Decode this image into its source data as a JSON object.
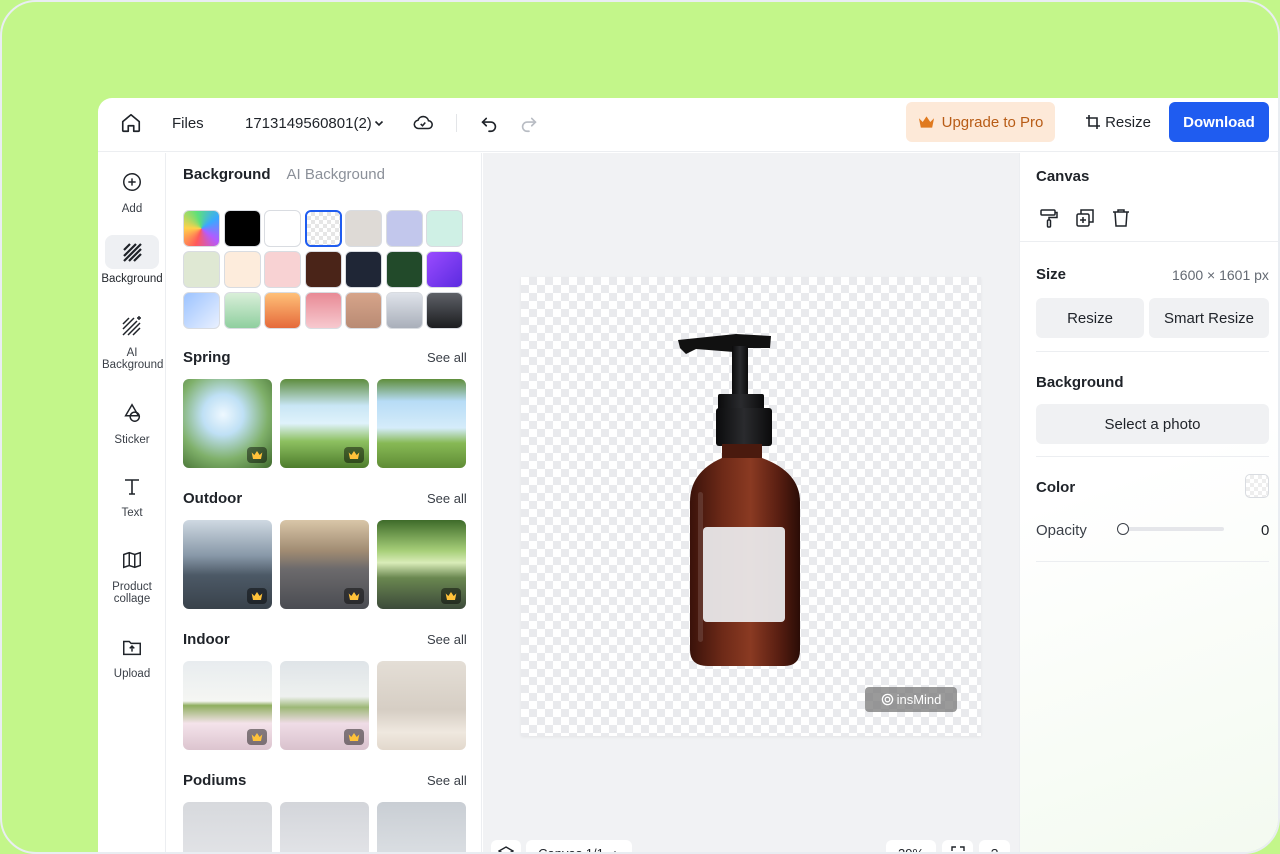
{
  "topbar": {
    "files_label": "Files",
    "file_name": "1713149560801(2)",
    "upgrade_label": "Upgrade to Pro",
    "resize_label": "Resize",
    "download_label": "Download"
  },
  "rail": {
    "items": [
      {
        "label": "Add"
      },
      {
        "label": "Background"
      },
      {
        "label": "AI Background"
      },
      {
        "label": "Sticker"
      },
      {
        "label": "Text"
      },
      {
        "label": "Product collage"
      },
      {
        "label": "Upload"
      }
    ]
  },
  "panel": {
    "tabs": [
      {
        "label": "Background"
      },
      {
        "label": "AI Background"
      }
    ],
    "swatch_colors": [
      "rainbow",
      "#000000",
      "#ffffff",
      "transparent",
      "#dedad6",
      "#c2c7ec",
      "#cff0e5",
      "#dfe8d3",
      "#fdecdc",
      "#f8d2d3",
      "#4a2418",
      "#1f2636",
      "#224a2a",
      "#7c3aed",
      "blue-gradient",
      "green-gradient",
      "orange-gradient",
      "pink-gradient",
      "tan-gradient",
      "gray-gradient",
      "dark-gradient"
    ],
    "sections": [
      {
        "title": "Spring",
        "see_all": "See all"
      },
      {
        "title": "Outdoor",
        "see_all": "See all"
      },
      {
        "title": "Indoor",
        "see_all": "See all"
      },
      {
        "title": "Podiums",
        "see_all": "See all"
      }
    ]
  },
  "canvas": {
    "watermark": "insMind",
    "page_label": "Canvas 1/1",
    "zoom": "29%",
    "help": "?"
  },
  "right_panel": {
    "canvas_title": "Canvas",
    "size_label": "Size",
    "size_value": "1600 × 1601 px",
    "resize_btn": "Resize",
    "smart_resize_btn": "Smart Resize",
    "background_label": "Background",
    "select_photo_btn": "Select a photo",
    "color_label": "Color",
    "opacity_label": "Opacity",
    "opacity_value": "0"
  },
  "colors": {
    "accent": "#1f5cf0",
    "upgrade_bg": "#fde9d8",
    "upgrade_text": "#b85c16",
    "frame_bg": "#c3f68a"
  }
}
